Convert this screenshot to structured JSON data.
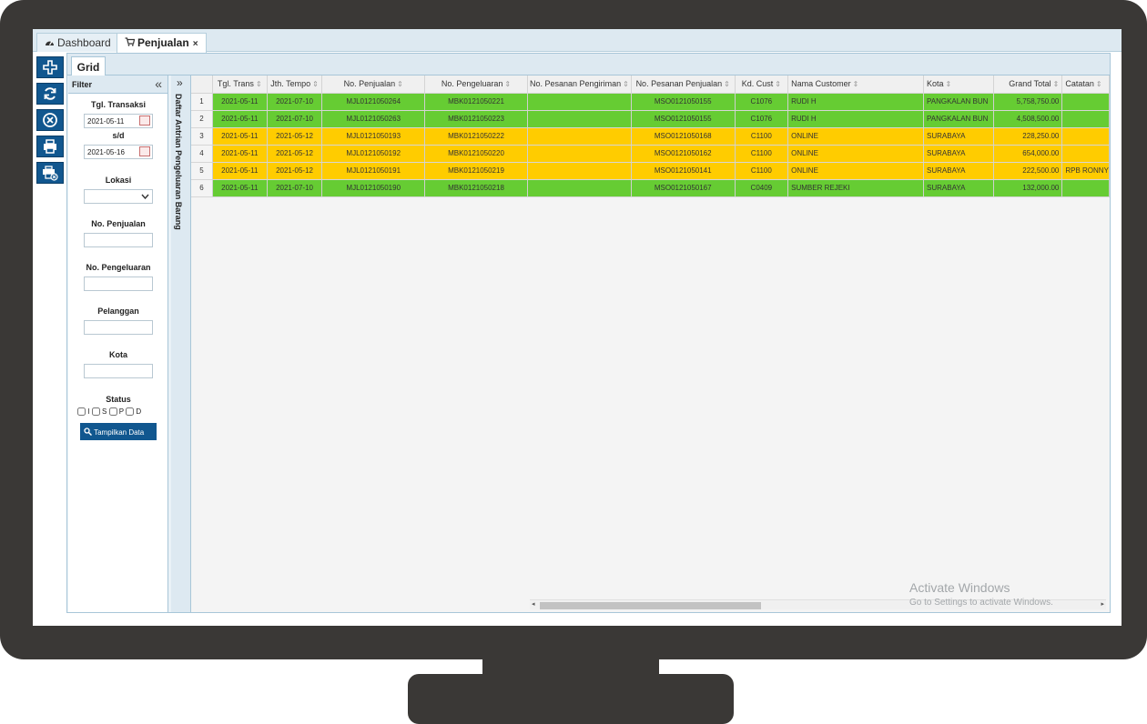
{
  "tabs": [
    {
      "label": "Dashboard",
      "icon": "dashboard-icon"
    },
    {
      "label": "Penjualan",
      "icon": "cart-icon",
      "close": "×"
    }
  ],
  "toolbar": {
    "buttons": [
      {
        "name": "add-button",
        "icon": "plus-icon"
      },
      {
        "name": "refresh-button",
        "icon": "refresh-icon"
      },
      {
        "name": "cancel-button",
        "icon": "cancel-circle-icon"
      },
      {
        "name": "print-button",
        "icon": "printer-icon"
      },
      {
        "name": "print-cancel-button",
        "icon": "printer-cancel-icon"
      }
    ]
  },
  "grid_tab": "Grid",
  "filter": {
    "title": "Filter",
    "collapse": "«",
    "tgl_label": "Tgl. Transaksi",
    "tgl_from": "2021-05-11",
    "sd_label": "s/d",
    "tgl_to": "2021-05-16",
    "lokasi_label": "Lokasi",
    "lokasi_value": "",
    "no_penjualan_label": "No. Penjualan",
    "no_pengeluaran_label": "No. Pengeluaran",
    "pelanggan_label": "Pelanggan",
    "kota_label": "Kota",
    "status_label": "Status",
    "status_options": [
      "I",
      "S",
      "P",
      "D"
    ],
    "show_button": "Tampilkan Data"
  },
  "side_panel": {
    "expand": "»",
    "title": "Daftar Antrian Pengeluaran Barang"
  },
  "table": {
    "columns": [
      "Tgl. Trans",
      "Jth. Tempo",
      "No. Penjualan",
      "No. Pengeluaran",
      "No. Pesanan Pengiriman",
      "No. Pesanan Penjualan",
      "Kd. Cust",
      "Nama Customer",
      "Kota",
      "Grand Total",
      "Catatan"
    ],
    "rows": [
      {
        "no": "1",
        "status": "green",
        "cells": [
          "2021-05-11",
          "2021-07-10",
          "MJL0121050264",
          "MBK0121050221",
          "",
          "MSO0121050155",
          "C1076",
          "RUDI H",
          "PANGKALAN BUN",
          "5,758,750.00",
          ""
        ]
      },
      {
        "no": "2",
        "status": "green",
        "cells": [
          "2021-05-11",
          "2021-07-10",
          "MJL0121050263",
          "MBK0121050223",
          "",
          "MSO0121050155",
          "C1076",
          "RUDI H",
          "PANGKALAN BUN",
          "4,508,500.00",
          ""
        ]
      },
      {
        "no": "3",
        "status": "yellow",
        "cells": [
          "2021-05-11",
          "2021-05-12",
          "MJL0121050193",
          "MBK0121050222",
          "",
          "MSO0121050168",
          "C1100",
          "ONLINE",
          "SURABAYA",
          "228,250.00",
          ""
        ]
      },
      {
        "no": "4",
        "status": "yellow",
        "cells": [
          "2021-05-11",
          "2021-05-12",
          "MJL0121050192",
          "MBK0121050220",
          "",
          "MSO0121050162",
          "C1100",
          "ONLINE",
          "SURABAYA",
          "654,000.00",
          ""
        ]
      },
      {
        "no": "5",
        "status": "yellow",
        "cells": [
          "2021-05-11",
          "2021-05-12",
          "MJL0121050191",
          "MBK0121050219",
          "",
          "MSO0121050141",
          "C1100",
          "ONLINE",
          "SURABAYA",
          "222,500.00",
          "RPB RONNY"
        ]
      },
      {
        "no": "6",
        "status": "green",
        "cells": [
          "2021-05-11",
          "2021-07-10",
          "MJL0121050190",
          "MBK0121050218",
          "",
          "MSO0121050167",
          "C0409",
          "SUMBER REJEKI",
          "SURABAYA",
          "132,000.00",
          ""
        ]
      }
    ]
  },
  "colors": {
    "green": "#66cc33",
    "yellow": "#ffcc00",
    "toolbar": "#11578f",
    "frame": "#3a3836"
  },
  "watermark": {
    "line1": "Activate Windows",
    "line2": "Go to Settings to activate Windows."
  }
}
